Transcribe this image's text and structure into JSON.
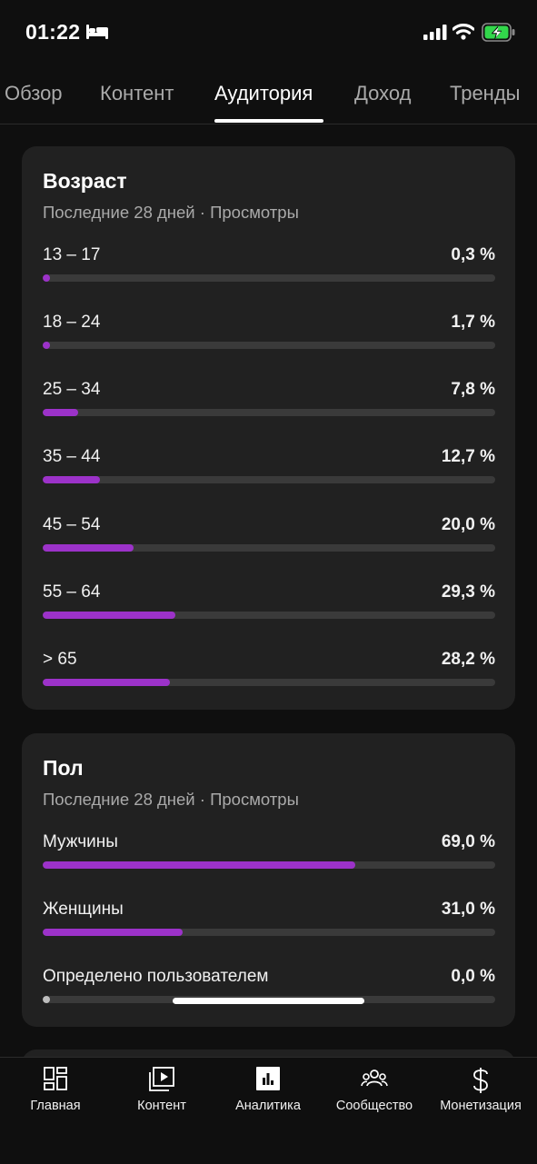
{
  "status_bar": {
    "time": "01:22",
    "bed_icon": "bed-icon",
    "signal_icon": "cellular-signal-icon",
    "wifi_icon": "wifi-icon",
    "battery_icon": "battery-charging-icon",
    "battery_color": "#32d74b"
  },
  "tabs": [
    {
      "label": "Обзор",
      "active": false
    },
    {
      "label": "Контент",
      "active": false
    },
    {
      "label": "Аудитория",
      "active": true
    },
    {
      "label": "Доход",
      "active": false
    },
    {
      "label": "Тренды",
      "active": false
    }
  ],
  "age_card": {
    "title": "Возраст",
    "subtitle": "Последние 28 дней · Просмотры",
    "rows": [
      {
        "label": "13 – 17",
        "value": "0,3 %",
        "percent": 0.3
      },
      {
        "label": "18 – 24",
        "value": "1,7 %",
        "percent": 1.7
      },
      {
        "label": "25 – 34",
        "value": "7,8 %",
        "percent": 7.8
      },
      {
        "label": "35 – 44",
        "value": "12,7 %",
        "percent": 12.7
      },
      {
        "label": "45 – 54",
        "value": "20,0 %",
        "percent": 20.0
      },
      {
        "label": "55 – 64",
        "value": "29,3 %",
        "percent": 29.3
      },
      {
        "label": "> 65",
        "value": "28,2 %",
        "percent": 28.2
      }
    ]
  },
  "gender_card": {
    "title": "Пол",
    "subtitle": "Последние 28 дней · Просмотры",
    "rows": [
      {
        "label": "Мужчины",
        "value": "69,0 %",
        "percent": 69.0
      },
      {
        "label": "Женщины",
        "value": "31,0 %",
        "percent": 31.0
      },
      {
        "label": "Определено пользователем",
        "value": "0,0 %",
        "percent": 0.0
      }
    ]
  },
  "bottom_nav": [
    {
      "label": "Главная",
      "icon": "dashboard-icon"
    },
    {
      "label": "Контент",
      "icon": "content-play-icon"
    },
    {
      "label": "Аналитика",
      "icon": "analytics-icon",
      "active": true
    },
    {
      "label": "Сообщество",
      "icon": "community-icon"
    },
    {
      "label": "Монетизация",
      "icon": "dollar-icon"
    }
  ],
  "colors": {
    "accent": "#9c32c9",
    "background": "#0f0f0f",
    "card": "#212121",
    "track": "#3a3a3a"
  }
}
